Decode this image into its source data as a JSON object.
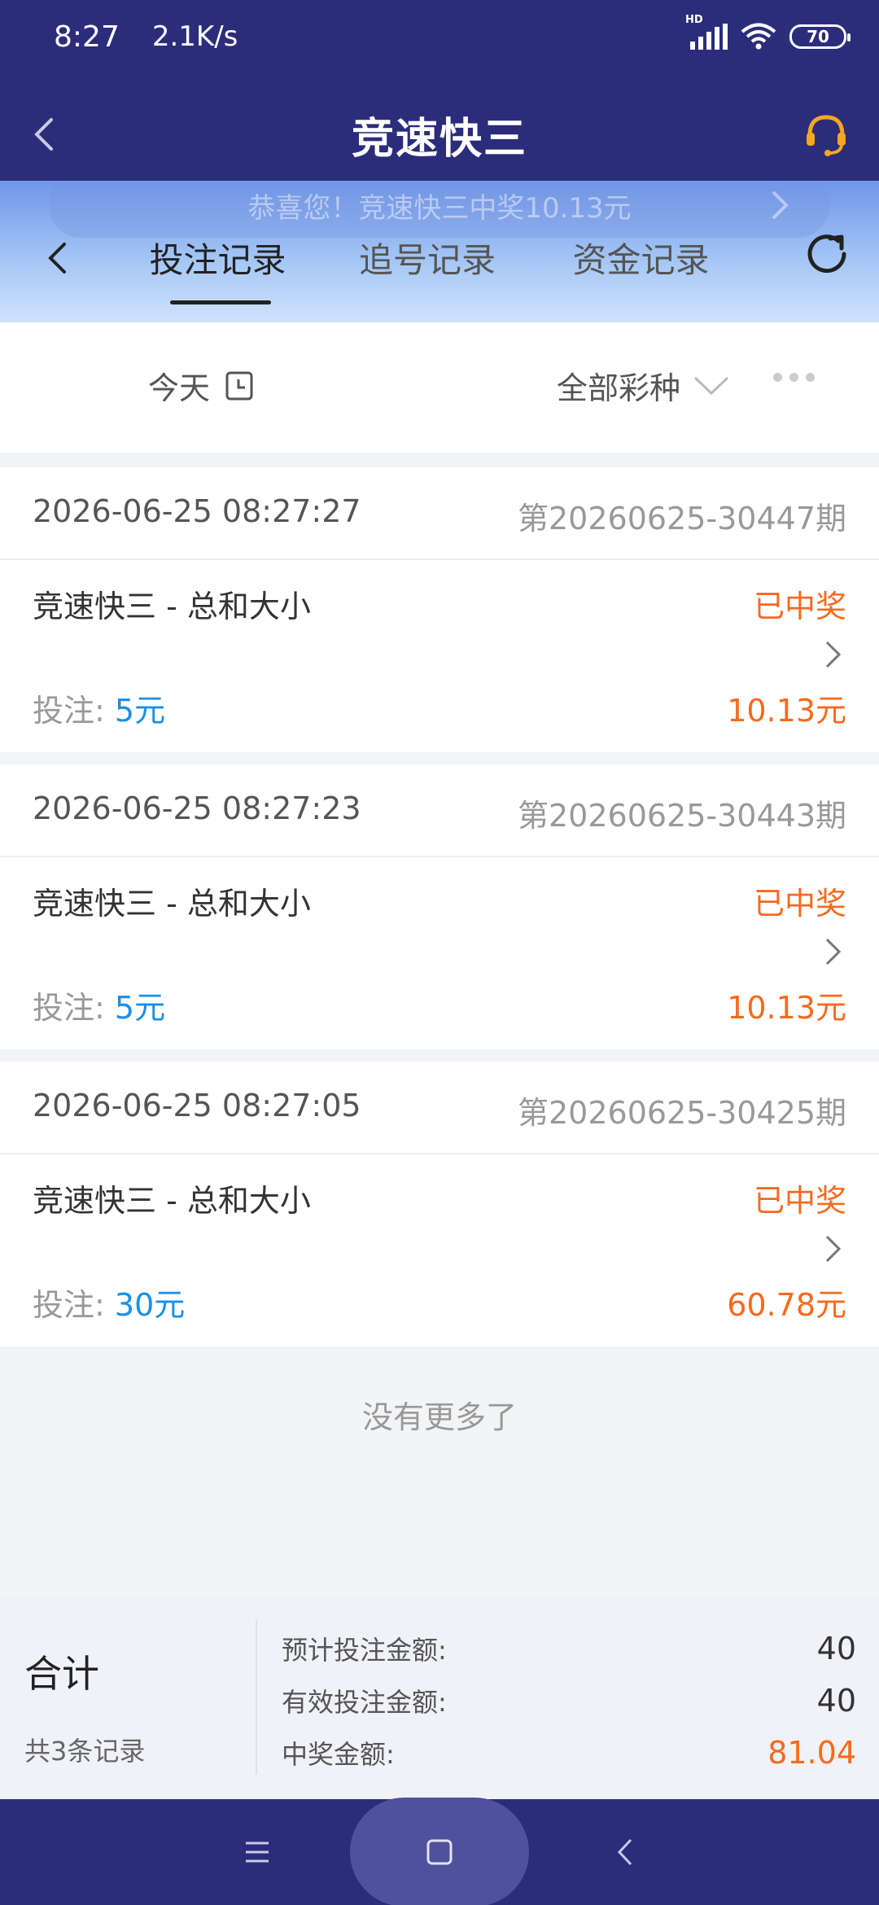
{
  "status_bar": {
    "time": "8:27",
    "speed": "2.1K/s",
    "network": "HD",
    "battery": "70"
  },
  "header": {
    "title": "竞速快三"
  },
  "toast": {
    "text": "恭喜您！竞速快三中奖10.13元"
  },
  "tabs": [
    {
      "label": "投注记录",
      "active": true
    },
    {
      "label": "追号记录",
      "active": false
    },
    {
      "label": "资金记录",
      "active": false
    }
  ],
  "filters": {
    "date": "今天",
    "lottery_type": "全部彩种"
  },
  "records": [
    {
      "time": "2026-06-25 08:27:27",
      "issue": "第20260625-30447期",
      "name": "竞速快三 - 总和大小",
      "status": "已中奖",
      "bet_label": "投注:",
      "bet_amount": "5元",
      "win_amount": "10.13元"
    },
    {
      "time": "2026-06-25 08:27:23",
      "issue": "第20260625-30443期",
      "name": "竞速快三 - 总和大小",
      "status": "已中奖",
      "bet_label": "投注:",
      "bet_amount": "5元",
      "win_amount": "10.13元"
    },
    {
      "time": "2026-06-25 08:27:05",
      "issue": "第20260625-30425期",
      "name": "竞速快三 - 总和大小",
      "status": "已中奖",
      "bet_label": "投注:",
      "bet_amount": "30元",
      "win_amount": "60.78元"
    }
  ],
  "no_more": "没有更多了",
  "summary": {
    "title": "合计",
    "count": "共3条记录",
    "rows": [
      {
        "label": "预计投注金额:",
        "value": "40"
      },
      {
        "label": "有效投注金额:",
        "value": "40"
      },
      {
        "label": "中奖金额:",
        "value": "81.04"
      }
    ]
  },
  "colors": {
    "header_bg": "#2c2d7a",
    "accent_orange": "#f66a1d",
    "accent_blue": "#1a8fe8"
  }
}
